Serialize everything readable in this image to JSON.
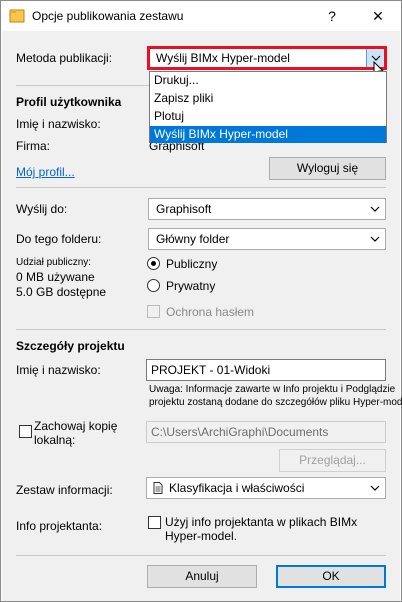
{
  "window": {
    "title": "Opcje publikowania zestawu",
    "help_label": "?",
    "close_label": "✕"
  },
  "publish_method": {
    "label": "Metoda publikacji:",
    "value": "Wyślij BIMx Hyper-model",
    "options": [
      "Drukuj...",
      "Zapisz pliki",
      "Plotuj",
      "Wyślij BIMx Hyper-model"
    ]
  },
  "user_profile": {
    "heading": "Profil użytkownika",
    "name_label": "Imię i nazwisko:",
    "company_label": "Firma:",
    "company_value": "Graphisoft",
    "my_profile_link": "Mój profil...",
    "logout_button": "Wyloguj się"
  },
  "send_to": {
    "label": "Wyślij do:",
    "value": "Graphisoft"
  },
  "folder": {
    "label": "Do tego folderu:",
    "value": "Główny folder"
  },
  "sharing": {
    "label": "Udział publiczny:",
    "used": "0 MB używane",
    "available": "5.0 GB dostępne",
    "public_label": "Publiczny",
    "private_label": "Prywatny",
    "password_label": "Ochrona hasłem"
  },
  "project_details": {
    "heading": "Szczegóły projektu",
    "name_label": "Imię i nazwisko:",
    "name_value": "PROJEKT - 01-Widoki",
    "note_line1": "Uwaga: Informacje zawarte w Info projektu i Podglądzie",
    "note_line2": "projektu zostaną dodane do szczegółów pliku Hyper-model."
  },
  "local_copy": {
    "label_line1": "Zachowaj kopię",
    "label_line2": "lokalną:",
    "path": "C:\\Users\\ArchiGraphi\\Documents",
    "browse_button": "Przeglądaj..."
  },
  "info_set": {
    "label": "Zestaw informacji:",
    "value": "Klasyfikacja i właściwości"
  },
  "designer_info": {
    "label": "Info projektanta:",
    "checkbox_line1": "Użyj info projektanta w plikach BIMx",
    "checkbox_line2": "Hyper-model."
  },
  "footer": {
    "cancel_button": "Anuluj",
    "ok_button": "OK"
  }
}
